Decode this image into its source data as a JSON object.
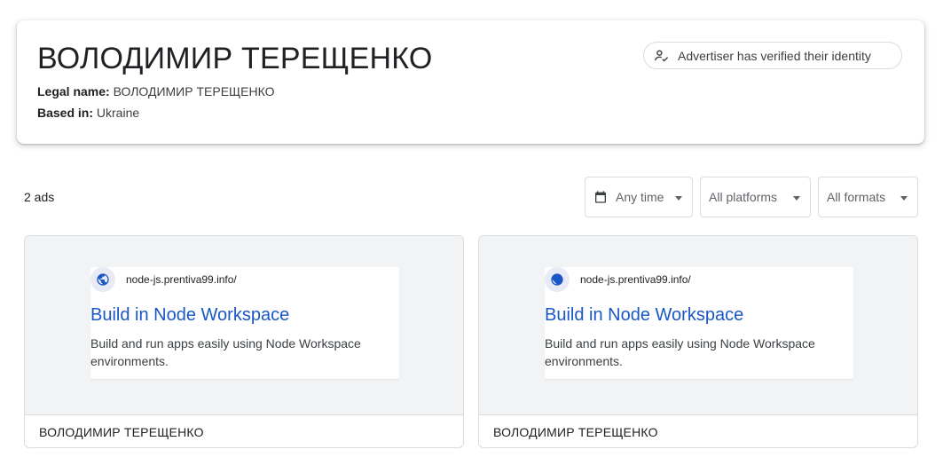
{
  "advertiser": {
    "name": "ВОЛОДИМИР ТЕРЕЩЕНКО",
    "legal_label": "Legal name:",
    "legal_value": "ВОЛОДИМИР ТЕРЕЩЕНКО",
    "based_label": "Based in:",
    "based_value": "Ukraine",
    "verified_text": "Advertiser has verified their identity",
    "verified_icon": "person-check-icon"
  },
  "results": {
    "count_text": "2 ads"
  },
  "filters": {
    "time": {
      "label": "Any time",
      "icon": "calendar-icon"
    },
    "platforms": {
      "label": "All platforms"
    },
    "formats": {
      "label": "All formats"
    }
  },
  "ads": [
    {
      "url": "node-js.prentiva99.info/",
      "title": "Build in Node Workspace",
      "description": "Build and run apps easily using Node Workspace environments.",
      "advertiser": "ВОЛОДИМИР ТЕРЕЩЕНКО"
    },
    {
      "url": "node-js.prentiva99.info/",
      "title": "Build in Node Workspace",
      "description": "Build and run apps easily using Node Workspace environments.",
      "advertiser": "ВОЛОДИМИР ТЕРЕЩЕНКО"
    }
  ],
  "colors": {
    "link_blue": "#1a57c6",
    "preview_bg": "#f1f3f4",
    "border": "#dadce0",
    "globe_blue": "#1a57c6"
  }
}
